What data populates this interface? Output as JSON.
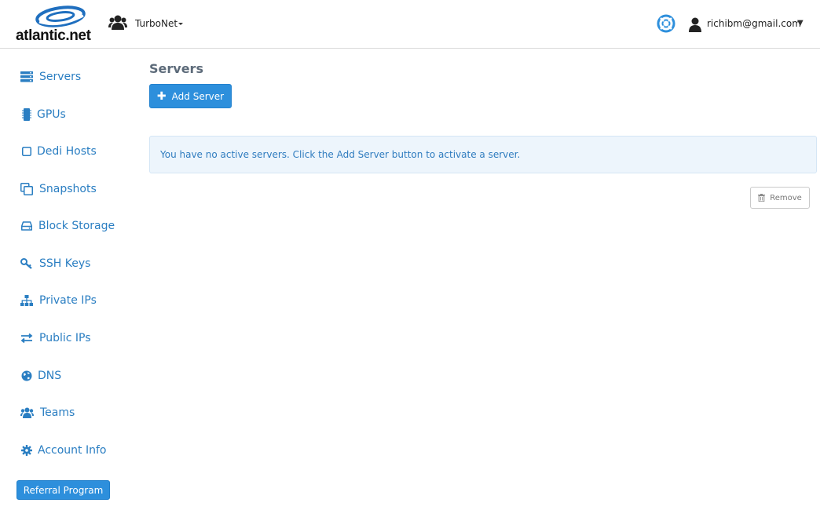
{
  "header": {
    "logo_text": "atlantic.net",
    "team_name": "TurboNet",
    "user_email": "richibm@gmail.com",
    "user_caret": "▼"
  },
  "sidebar": {
    "items": [
      {
        "label": "Servers",
        "icon": "servers-icon"
      },
      {
        "label": "GPUs",
        "icon": "gpu-chip-icon"
      },
      {
        "label": "Dedi Hosts",
        "icon": "dedicated-host-icon"
      },
      {
        "label": "Snapshots",
        "icon": "snapshots-icon"
      },
      {
        "label": "Block Storage",
        "icon": "hard-drive-icon"
      },
      {
        "label": "SSH Keys",
        "icon": "key-icon"
      },
      {
        "label": "Private IPs",
        "icon": "network-sitemap-icon"
      },
      {
        "label": "Public IPs",
        "icon": "exchange-arrows-icon"
      },
      {
        "label": "DNS",
        "icon": "globe-icon"
      },
      {
        "label": "Teams",
        "icon": "users-icon"
      },
      {
        "label": "Account Info",
        "icon": "gear-icon"
      }
    ],
    "referral_label": "Referral Program"
  },
  "main": {
    "title": "Servers",
    "add_button_label": "Add Server",
    "alert_text": "You have no active servers. Click the Add Server button to activate a server.",
    "remove_button_label": "Remove"
  },
  "colors": {
    "accent": "#2d8fdc",
    "link": "#2a7ec2",
    "alert_bg": "#edf5fc"
  }
}
